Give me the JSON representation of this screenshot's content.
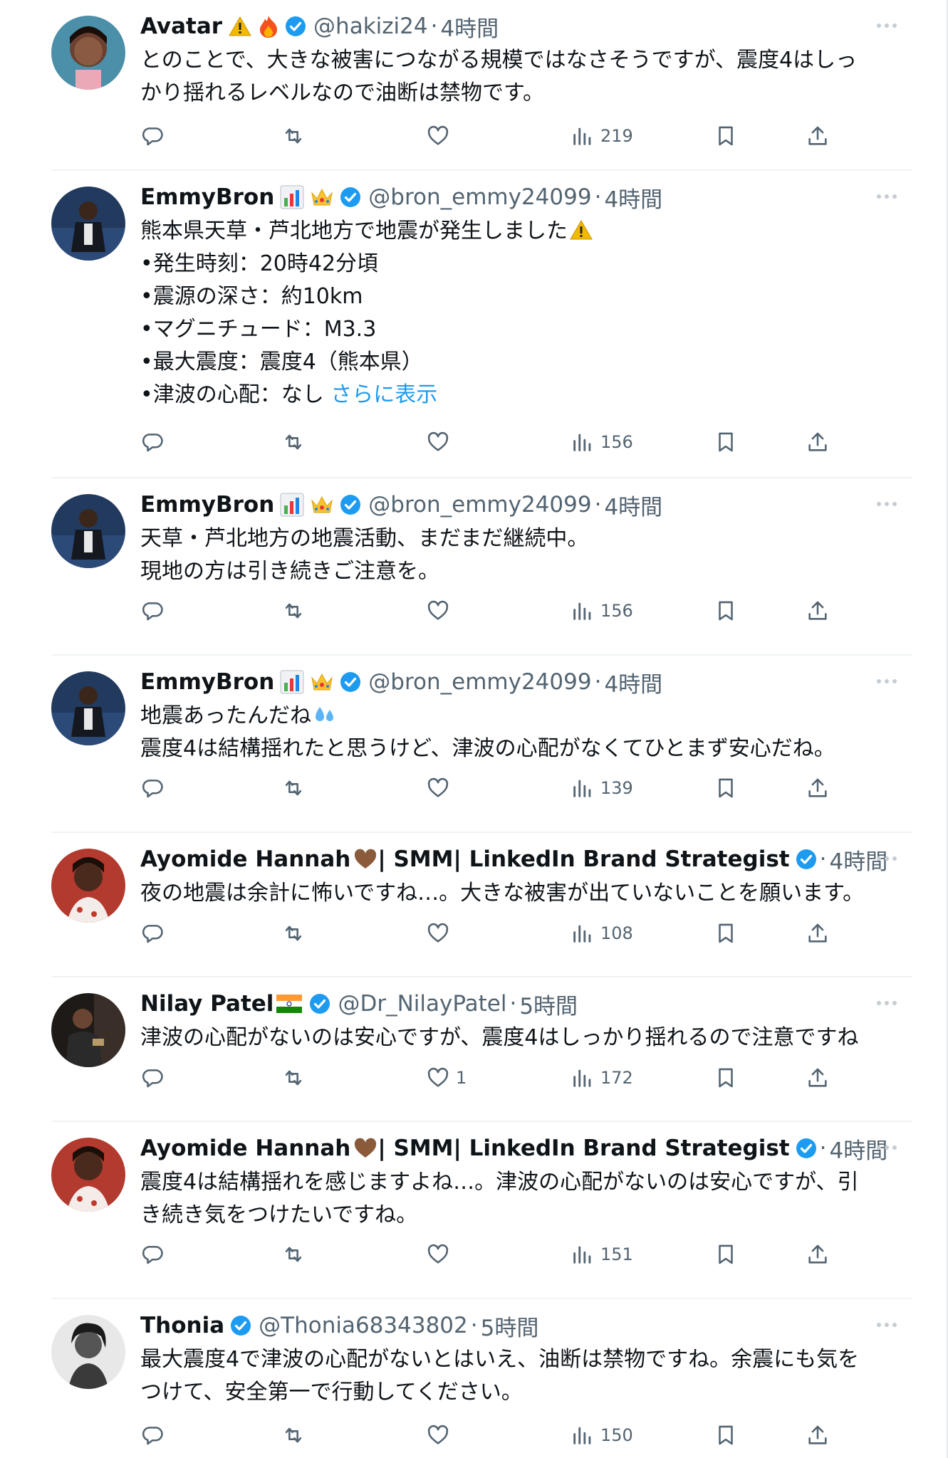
{
  "tweets": [
    {
      "name": "Avatar",
      "handle": "@hakizi24",
      "time": "4時間",
      "lines": [
        "とのことで、大きな被害につながる規模ではなさそうですが、震度4はしっ",
        "かり揺れるレベルなので油断は禁物です。"
      ],
      "likes": "",
      "views": "219"
    },
    {
      "name": "EmmyBron",
      "handle": "@bron_emmy24099",
      "time": "4時間",
      "lines": [
        "熊本県天草・芦北地方で地震が発生しました",
        "•発生時刻：20時42分頃",
        "•震源の深さ：約10km",
        "•マグニチュード：M3.3",
        "•最大震度：震度4（熊本県）",
        "•津波の心配：なし "
      ],
      "show_more": "さらに表示",
      "likes": "",
      "views": "156"
    },
    {
      "name": "EmmyBron",
      "handle": "@bron_emmy24099",
      "time": "4時間",
      "lines": [
        "天草・芦北地方の地震活動、まだまだ継続中。",
        "現地の方は引き続きご注意を。"
      ],
      "likes": "",
      "views": "156"
    },
    {
      "name": "EmmyBron",
      "handle": "@bron_emmy24099",
      "time": "4時間",
      "lines": [
        "地震あったんだね",
        "震度4は結構揺れたと思うけど、津波の心配がなくてひとまず安心だね。"
      ],
      "likes": "",
      "views": "139"
    },
    {
      "name": "Ayomide Hannah",
      "name_suffix": "| SMM| LinkedIn Brand Strategist",
      "handle": "",
      "time": "4時間",
      "lines": [
        "夜の地震は余計に怖いですね…。大きな被害が出ていないことを願います。"
      ],
      "likes": "",
      "views": "108"
    },
    {
      "name": "Nilay Patel",
      "handle": "@Dr_NilayPatel",
      "time": "5時間",
      "lines": [
        "津波の心配がないのは安心ですが、震度4はしっかり揺れるので注意ですね"
      ],
      "likes": "1",
      "views": "172"
    },
    {
      "name": "Ayomide Hannah",
      "name_suffix": "| SMM| LinkedIn Brand Strategist",
      "handle": "",
      "time": "4時間",
      "lines": [
        "震度4は結構揺れを感じますよね…。津波の心配がないのは安心ですが、引",
        "き続き気をつけたいですね。"
      ],
      "likes": "",
      "views": "151"
    },
    {
      "name": "Thonia",
      "handle": "@Thonia68343802",
      "time": "5時間",
      "lines": [
        "最大震度4で津波の心配がないとはいえ、油断は禁物ですね。余震にも気を",
        "つけて、安全第一で行動してください。"
      ],
      "likes": "",
      "views": "150"
    }
  ],
  "colors": {
    "text": "#0f1419",
    "secondary": "#536471",
    "verified": "#1d9bf0",
    "link": "#1d9bf0",
    "divider": "#eff3f4"
  },
  "icons": [
    "warning-icon",
    "fire-icon",
    "verified-badge-icon",
    "chart-emoji-icon",
    "crown-emoji-icon",
    "sweat-emoji-icon",
    "brown-heart-icon",
    "india-flag-icon",
    "more-icon",
    "reply-icon",
    "retweet-icon",
    "like-icon",
    "views-icon",
    "bookmark-icon",
    "share-icon"
  ]
}
